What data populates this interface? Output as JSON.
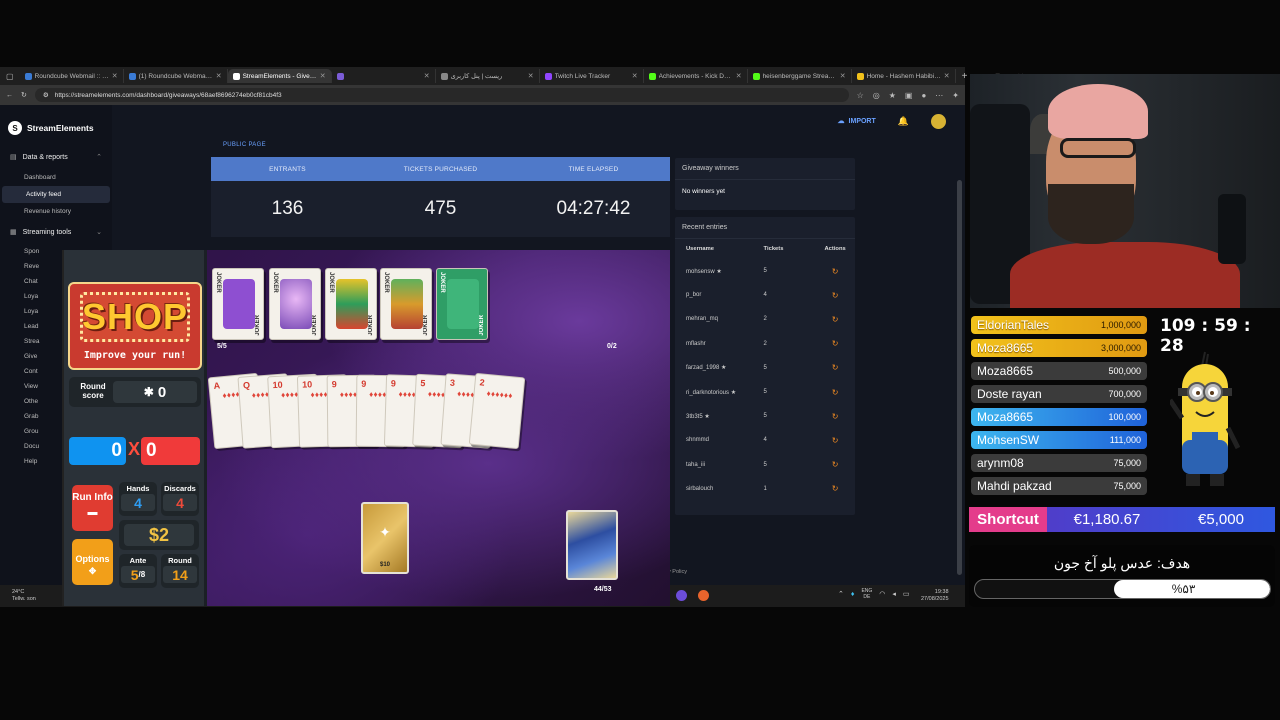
{
  "browser": {
    "tabs": [
      {
        "title": "Roundcube Webmail :: Inbox",
        "color": "#3a7bd5"
      },
      {
        "title": "(1) Roundcube Webmail :: Inbox",
        "color": "#3a7bd5"
      },
      {
        "title": "StreamElements - Giveaway",
        "color": "#ffffff",
        "active": true
      },
      {
        "title": "",
        "color": "#7b5cd6"
      },
      {
        "title": "ریست | پنل کاربری",
        "color": "#888888"
      },
      {
        "title": "Twitch Live Tracker",
        "color": "#9146ff"
      },
      {
        "title": "Achievements - Kick Dashb",
        "color": "#53fc18"
      },
      {
        "title": "heisenberggame Stream - Y",
        "color": "#53fc18"
      },
      {
        "title": "Home - Hashem Habibian",
        "color": "#f2c21b"
      }
    ],
    "url": "https://streamelements.com/dashboard/giveaways/68aef8696274eb0cf81cb4f3"
  },
  "se": {
    "brand": "StreamElements",
    "nav": {
      "data_reports": "Data & reports",
      "dashboard": "Dashboard",
      "activity_feed": "Activity feed",
      "revenue_history": "Revenue history",
      "streaming_tools": "Streaming tools",
      "trunc": [
        "Spon",
        "Reve",
        "Chat",
        "Loya",
        "Loya",
        "Lead",
        "Strea",
        "Give",
        "Cont",
        "View",
        "Othe",
        "Grab",
        "Grou",
        "Docu",
        "Help"
      ]
    },
    "import_label": "IMPORT",
    "public_page": "PUBLIC PAGE",
    "stats": {
      "headers": [
        "ENTRANTS",
        "TICKETS PURCHASED",
        "TIME ELAPSED"
      ],
      "values": [
        "136",
        "475",
        "04:27:42"
      ]
    },
    "winners": {
      "title": "Giveaway winners",
      "empty": "No winners yet"
    },
    "entries": {
      "title": "Recent entries",
      "headers": [
        "Username",
        "Tickets",
        "Actions"
      ],
      "rows": [
        {
          "user": "mohsensw ★",
          "tickets": "5"
        },
        {
          "user": "p_bor",
          "tickets": "4"
        },
        {
          "user": "mehran_mq",
          "tickets": "2"
        },
        {
          "user": "mflashr",
          "tickets": "2"
        },
        {
          "user": "farzad_1998 ★",
          "tickets": "5"
        },
        {
          "user": "ri_darknotorious ★",
          "tickets": "5"
        },
        {
          "user": "3tb3t5 ★",
          "tickets": "5"
        },
        {
          "user": "shnmmd",
          "tickets": "4"
        },
        {
          "user": "taha_iii",
          "tickets": "5"
        },
        {
          "user": "sirbalouch",
          "tickets": "1"
        }
      ],
      "action_icon": "refresh-icon"
    },
    "privacy": "y Policy"
  },
  "taskbar": {
    "temp": "24°C",
    "weather_text": "Tellw. son",
    "lang": "ENG",
    "region": "DE",
    "time": "19:38",
    "date": "27/08/2025"
  },
  "game": {
    "shop_title": "SHOP",
    "shop_sub": "Improve your run!",
    "round_score_label": "Round score",
    "round_score": "0",
    "chips": "0",
    "mult": "0",
    "times": "X",
    "run_info": "Run Info",
    "options": "Options",
    "hands_label": "Hands",
    "hands": "4",
    "discards_label": "Discards",
    "discards": "4",
    "money": "$2",
    "ante_label": "Ante",
    "ante": "5",
    "ante_max": "8",
    "round_label": "Round",
    "round": "14",
    "joker_count": "5/5",
    "consumable_count": "0/2",
    "deck_count": "44/53",
    "joker_text": "JOKER",
    "voucher_price": "$10",
    "hand_ranks": [
      "A",
      "Q",
      "10",
      "10",
      "9",
      "9",
      "9",
      "5",
      "3",
      "2"
    ]
  },
  "overlay": {
    "donations": [
      {
        "name": "EldorianTales",
        "amount": "1,000,000",
        "style": "gold"
      },
      {
        "name": "Moza8665",
        "amount": "3,000,000",
        "style": "gold"
      },
      {
        "name": "Moza8665",
        "amount": "500,000",
        "style": "dgray"
      },
      {
        "name": "Doste rayan",
        "amount": "700,000",
        "style": "dgray"
      },
      {
        "name": "Moza8665",
        "amount": "100,000",
        "style": "blue"
      },
      {
        "name": "MohsenSW",
        "amount": "111,000",
        "style": "blue"
      },
      {
        "name": "arynm08",
        "amount": "75,000",
        "style": "dgray"
      },
      {
        "name": "Mahdi pakzad",
        "amount": "75,000",
        "style": "dgray"
      }
    ],
    "timer": "109 : 59 : 28",
    "goal_label": "Shortcut",
    "goal_current": "€1,180.67",
    "goal_target": "€5,000",
    "goal2_title": "هدف: عدس پلو آخ جون",
    "goal2_pct_text": "%۵۳",
    "goal2_progress": 0.53
  }
}
